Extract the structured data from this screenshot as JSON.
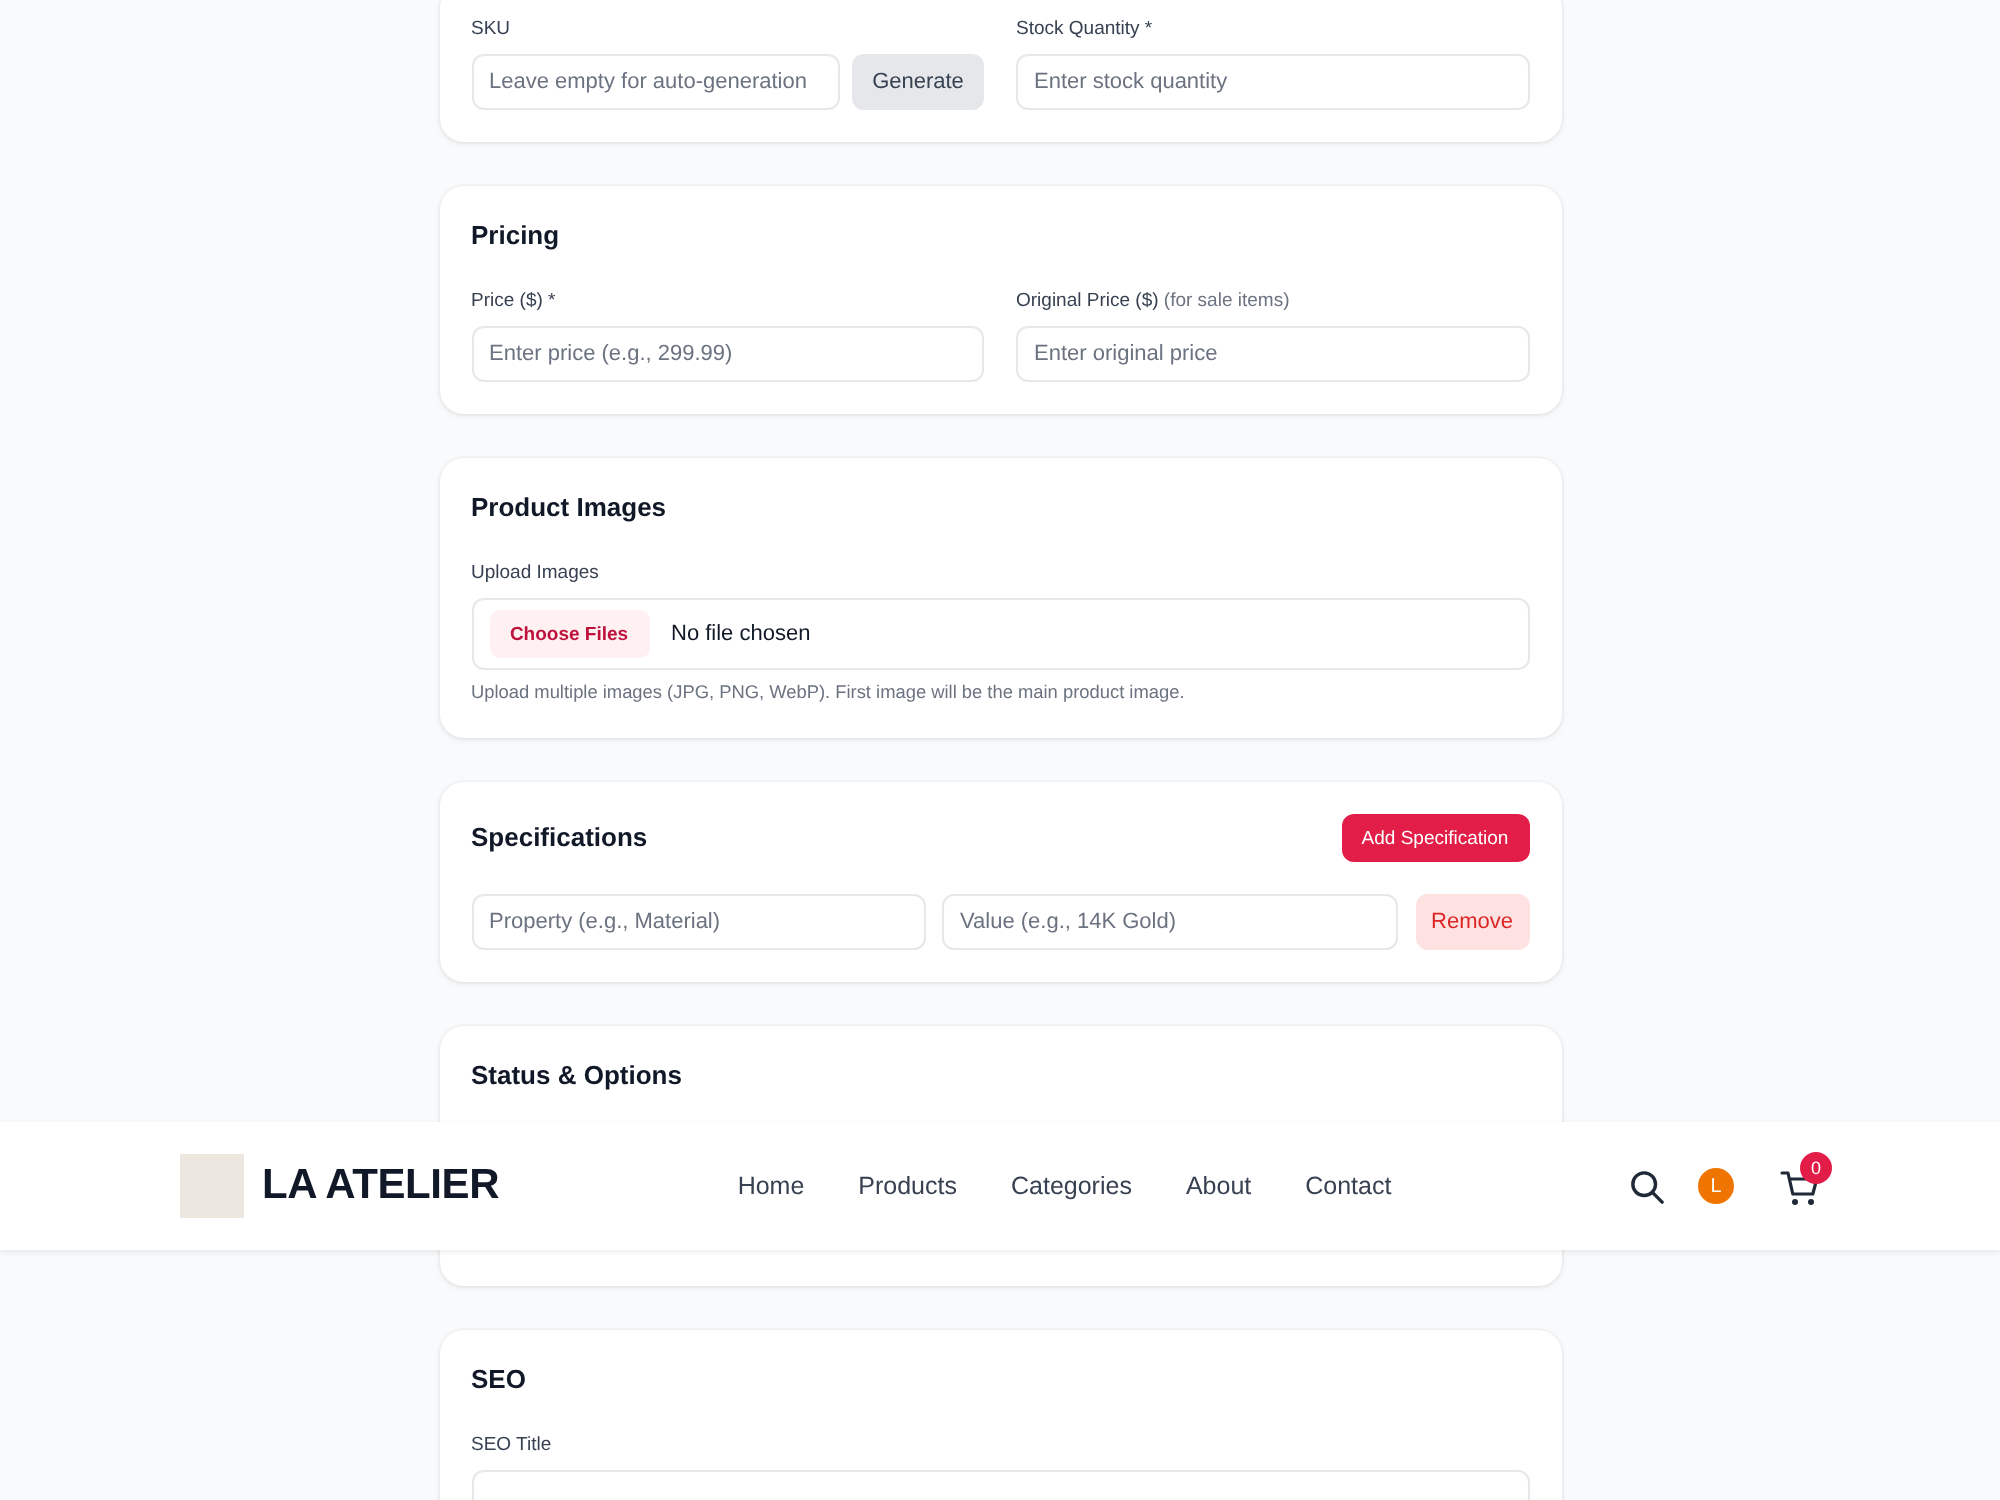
{
  "sections": [
    {
      "kind": "fields",
      "fields": [
        {
          "label": "SKU",
          "placeholder": "Leave empty for auto-generation",
          "button": "Generate"
        },
        {
          "label": "Stock Quantity *",
          "placeholder": "Enter stock quantity"
        }
      ]
    },
    {
      "kind": "fields",
      "title": "Pricing",
      "fields": [
        {
          "label": "Price ($) *",
          "placeholder": "Enter price (e.g., 299.99)"
        },
        {
          "label": "Original Price ($)",
          "note": "(for sale items)",
          "placeholder": "Enter original price"
        }
      ]
    },
    {
      "kind": "upload",
      "title": "Product Images",
      "label": "Upload Images",
      "button": "Choose Files",
      "status": "No file chosen",
      "help": "Upload multiple images (JPG, PNG, WebP). First image will be the main product image."
    },
    {
      "kind": "specs",
      "title": "Specifications",
      "add_button": "Add Specification",
      "rows": [
        {
          "property_placeholder": "Property (e.g., Material)",
          "value_placeholder": "Value (e.g., 14K Gold)",
          "remove_button": "Remove"
        }
      ]
    },
    {
      "kind": "options",
      "title": "Status & Options"
    },
    {
      "kind": "fields",
      "title": "SEO",
      "fields": [
        {
          "label": "SEO Title"
        }
      ]
    }
  ],
  "header": {
    "brand": "LA ATELIER",
    "nav": [
      {
        "label": "Home"
      },
      {
        "label": "Products"
      },
      {
        "label": "Categories"
      },
      {
        "label": "About"
      },
      {
        "label": "Contact"
      }
    ],
    "avatar_initial": "L",
    "cart_count": "0"
  }
}
